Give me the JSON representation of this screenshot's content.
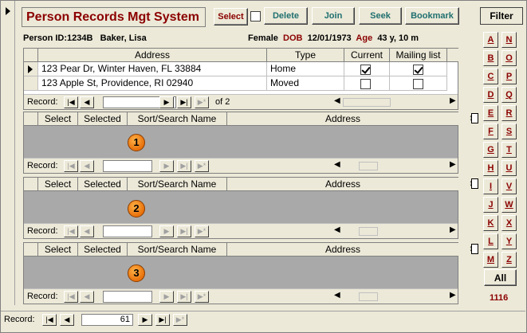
{
  "app_title": "Person Records Mgt System",
  "toolbar": {
    "select_label": "Select",
    "delete_label": "Delete",
    "join_label": "Join",
    "seek_label": "Seek",
    "bookmark_label": "Bookmark",
    "filter_label": "Filter"
  },
  "person": {
    "id_text": "Person ID:1234B",
    "name": "Baker, Lisa",
    "gender": "Female",
    "dob_label": "DOB",
    "dob": "12/01/1973",
    "age_label": "Age",
    "age": "43 y, 10 m"
  },
  "address_grid": {
    "columns": [
      "Address",
      "Type",
      "Current",
      "Mailing list"
    ],
    "rows": [
      {
        "address": "123 Pear Dr, Winter Haven, FL 33884",
        "type": "Home",
        "current": true,
        "mailing": true
      },
      {
        "address": "123 Apple St, Providence, RI 02940",
        "type": "Moved",
        "current": false,
        "mailing": false
      }
    ],
    "record_label": "Record:",
    "record_current": "1",
    "record_of": "of 2"
  },
  "subgrids": {
    "columns": [
      "Select",
      "Selected",
      "Sort/Search Name",
      "Address"
    ],
    "record_label": "Record:",
    "badges": [
      "1",
      "2",
      "3"
    ]
  },
  "letters_left": [
    "A",
    "B",
    "C",
    "D",
    "E",
    "F",
    "G",
    "H",
    "I",
    "J",
    "K",
    "L",
    "M"
  ],
  "letters_right": [
    "N",
    "O",
    "P",
    "Q",
    "R",
    "S",
    "T",
    "U",
    "V",
    "W",
    "X",
    "Y",
    "Z"
  ],
  "all_label": "All",
  "count": "1116",
  "main_nav": {
    "record_label": "Record:",
    "record_current": "61"
  }
}
